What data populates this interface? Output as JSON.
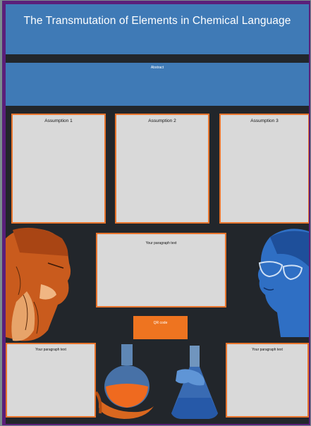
{
  "poster": {
    "title": "The Transmutation of Elements in Chemical Language",
    "abstract_label": "Abstract",
    "assumptions": [
      "Assumption 1",
      "Assumption 2",
      "Assumption 3"
    ],
    "center_paragraph": "Your paragraph text",
    "left_paragraph": "Your paragraph text",
    "right_paragraph": "Your paragraph text",
    "qr_label": "QR code"
  },
  "colors": {
    "band": "#3f7ab6",
    "box_border": "#e8742c",
    "background": "#22262b",
    "frame": "#5a1f7a",
    "accent": "#ee7420"
  },
  "icons": [
    "alchemist-illustration",
    "scientist-illustration",
    "round-flask-illustration",
    "erlenmeyer-flask-illustration"
  ]
}
